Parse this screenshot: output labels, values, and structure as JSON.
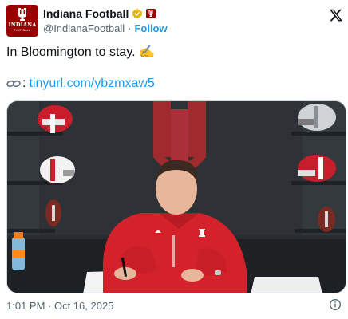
{
  "author": {
    "display_name": "Indiana Football",
    "handle": "@IndianaFootball",
    "separator": "·",
    "follow_label": "Follow",
    "avatar_text": "INDIANA",
    "avatar_subtext": "FOOTBALL"
  },
  "tweet": {
    "text": "In Bloomington to stay. ✍️",
    "link_prefix": ":",
    "link_url": "tinyurl.com/ybzmxaw5"
  },
  "footer": {
    "timestamp": "1:01 PM · Oct 16, 2025"
  },
  "icons": {
    "verified": "verified-badge-icon",
    "affiliate": "iu-affiliate-icon",
    "x_logo": "x-logo-icon",
    "link": "link-chain-icon",
    "info": "info-icon"
  },
  "colors": {
    "brand_crimson": "#990000",
    "link_blue": "#1d9bf0",
    "text_primary": "#0f1419",
    "text_secondary": "#536471",
    "verified_gold": "#e2b719"
  }
}
